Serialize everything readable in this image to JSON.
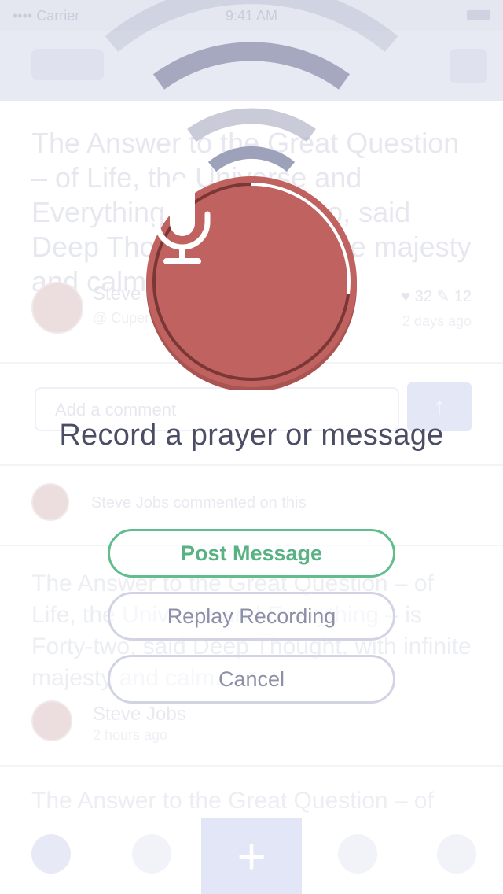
{
  "status_bar": {
    "carrier": "•••• Carrier",
    "time": "9:41 AM"
  },
  "background_feed": {
    "post_text": "The Answer to the Great Question – of Life, the Universe and Everything – is Forty-two, said Deep Thought, with infinite majesty and calm.",
    "author_name": "Steve Jobs",
    "author_sub": "@ Cupertino, CA",
    "stats": "♥ 32   ✎ 12",
    "time_ago": "2 days ago",
    "comment_placeholder": "Add a comment",
    "activity_text": "Steve Jobs commented on this",
    "post_text_2": "The Answer to the Great Question – of Life, the Universe and Everything – is Forty-two, said Deep Thought, with infinite majesty and calm.",
    "author2_name": "Steve Jobs",
    "author2_sub": "2 hours ago",
    "post_text_3": "The Answer to the Great Question – of"
  },
  "recording": {
    "prompt": "Record a prayer or message",
    "progress": 0.27,
    "colors": {
      "record_red": "#c0625f",
      "record_ring": "#a74c49",
      "post_green": "#62bd8e",
      "wave_grey": "#9ea1ba"
    },
    "icon": "microphone-icon"
  },
  "actions": {
    "post_label": "Post Message",
    "replay_label": "Replay Recording",
    "cancel_label": "Cancel"
  }
}
